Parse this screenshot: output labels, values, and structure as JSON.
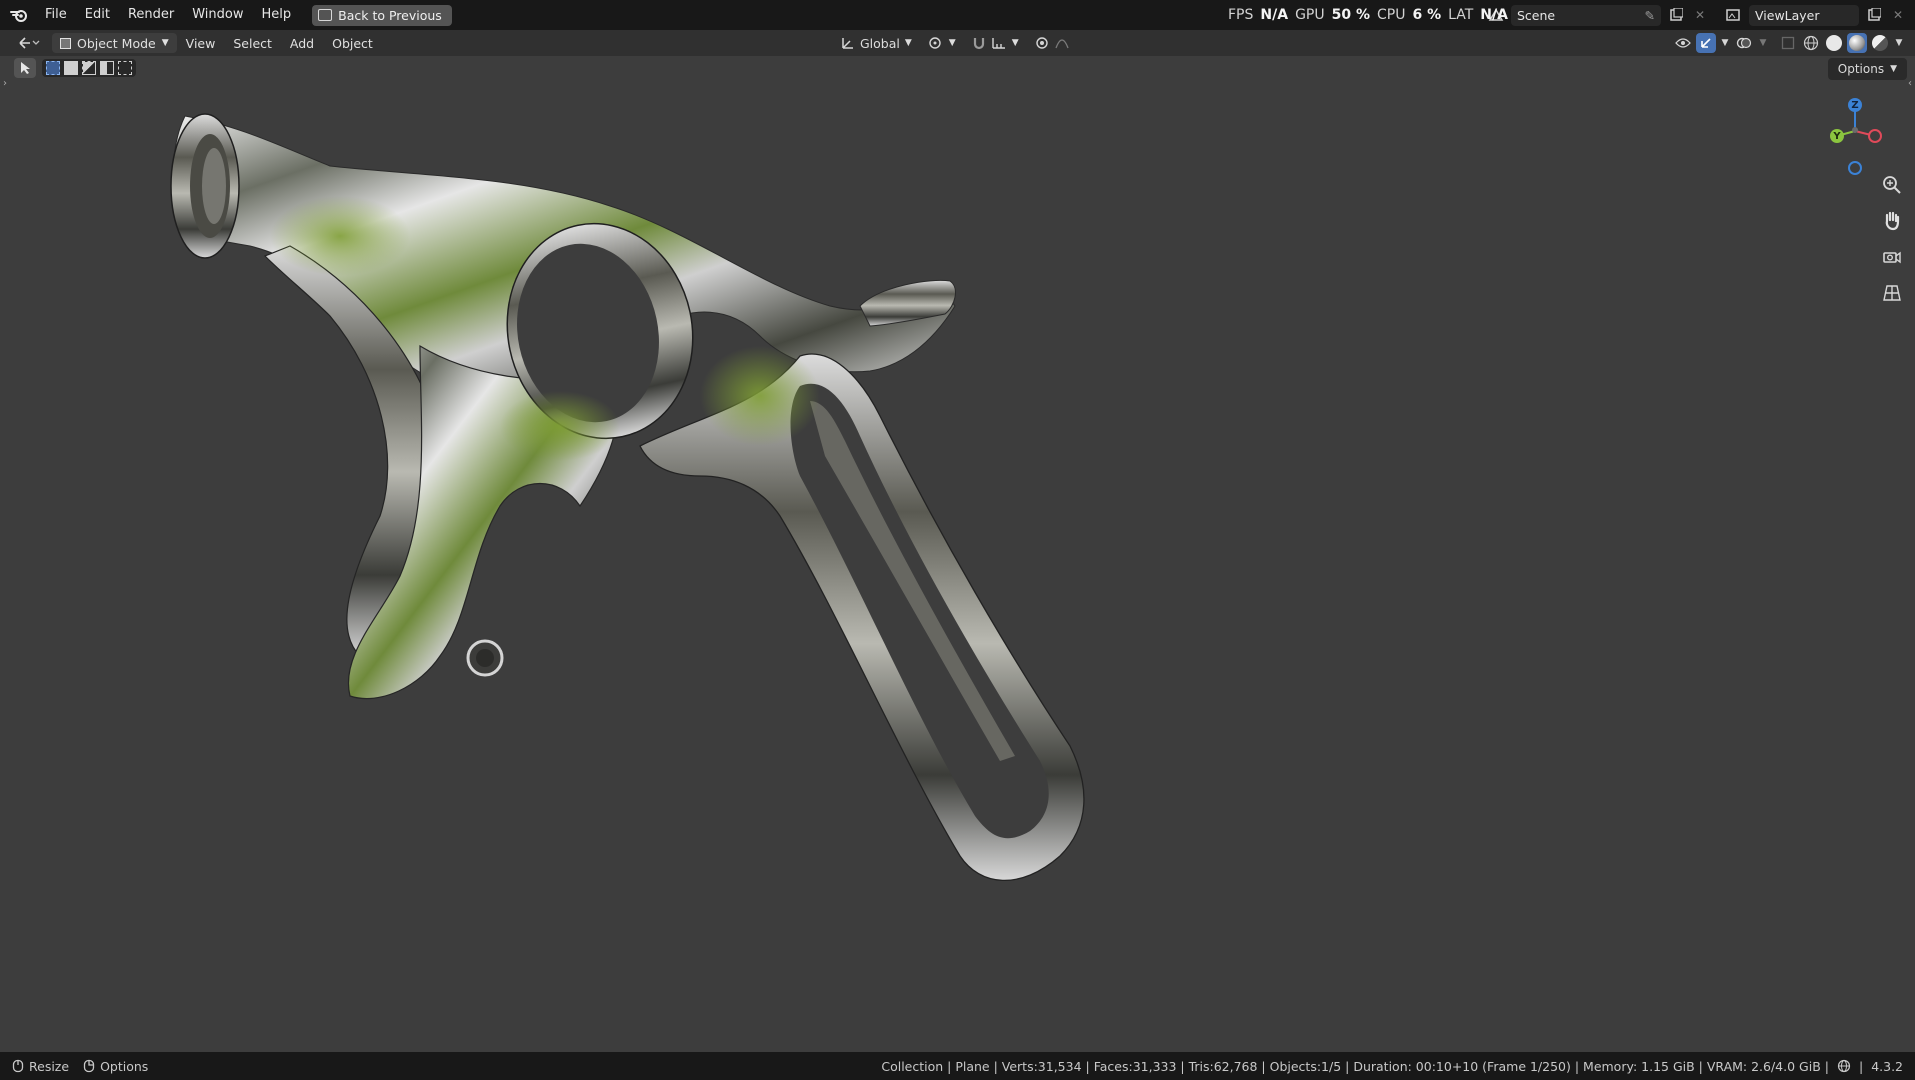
{
  "menu": {
    "items": [
      "File",
      "Edit",
      "Render",
      "Window",
      "Help"
    ],
    "back_button": "Back to Previous"
  },
  "topbar_right": {
    "scene": "Scene",
    "view_layer": "ViewLayer"
  },
  "header": {
    "mode": "Object Mode",
    "menus": [
      "View",
      "Select",
      "Add",
      "Object"
    ],
    "orientation": "Global"
  },
  "performance": {
    "fps_label": "FPS",
    "fps_value": "N/A",
    "gpu_label": "GPU",
    "gpu_value": "50 %",
    "cpu_label": "CPU",
    "cpu_value": "6 %",
    "lat_label": "LAT",
    "lat_value": "N/A"
  },
  "viewport": {
    "options_label": "Options",
    "gizmo": {
      "z": "Z",
      "y": "Y"
    }
  },
  "statusbar": {
    "left_items": [
      "Resize",
      "Options"
    ],
    "stats": "Collection | Plane | Verts:31,534 | Faces:31,333 | Tris:62,768 | Objects:1/5 | Duration: 00:10+10 (Frame 1/250) | Memory: 1.15 GiB | VRAM: 2.6/4.0 GiB |",
    "version": "4.3.2"
  },
  "colors": {
    "accent": "#4772b3",
    "axis_x": "#e04a5a",
    "axis_y": "#8bc53f",
    "axis_z": "#3b82d6",
    "viewport_bg": "#3d3d3d"
  }
}
